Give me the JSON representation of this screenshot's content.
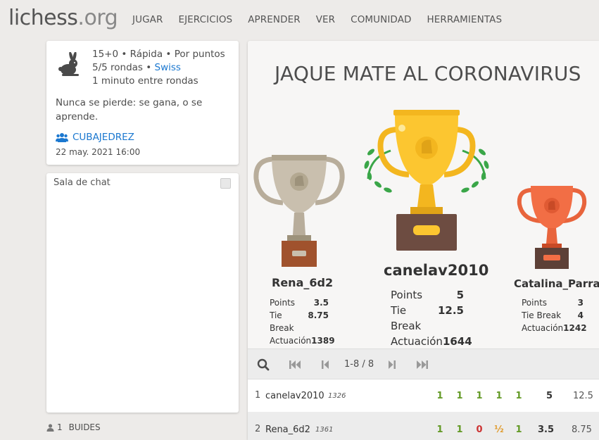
{
  "site": {
    "logo_main": "lichess",
    "logo_tld": ".org"
  },
  "nav": [
    "JUGAR",
    "EJERCICIOS",
    "APRENDER",
    "VER",
    "COMUNIDAD",
    "HERRAMIENTAS"
  ],
  "info": {
    "setup_line1": "15+0 • Rápida • Por puntos",
    "setup_line2_prefix": "5/5 rondas • ",
    "setup_line2_link": "Swiss",
    "setup_line3": "1 minuto entre rondas",
    "description": "Nunca se pierde: se gana, o se aprende.",
    "team": "CUBAJEDREZ",
    "date": "22 may. 2021 16:00"
  },
  "chat": {
    "title": "Sala de chat"
  },
  "spectators": {
    "count": "1",
    "label": "BUIDES"
  },
  "tournament": {
    "title": "JAQUE MATE AL CORONAVIRUS"
  },
  "podium": [
    {
      "place": 2,
      "name": "Rena_6d2",
      "points": "3.5",
      "tiebreak": "8.75",
      "performance": "1389"
    },
    {
      "place": 1,
      "name": "canelav2010",
      "points": "5",
      "tiebreak": "12.5",
      "performance": "1644"
    },
    {
      "place": 3,
      "name": "Catalina_Parra",
      "points": "3",
      "tiebreak": "4",
      "performance": "1242"
    }
  ],
  "stat_labels": {
    "points": "Points",
    "tiebreak": "Tie Break",
    "performance": "Actuación"
  },
  "pager": {
    "range": "1-8 / 8"
  },
  "standings": [
    {
      "rank": "1",
      "name": "canelav2010",
      "rating": "1326",
      "rounds": [
        "1",
        "1",
        "1",
        "1",
        "1"
      ],
      "total": "5",
      "tiebreak": "12.5"
    },
    {
      "rank": "2",
      "name": "Rena_6d2",
      "rating": "1361",
      "rounds": [
        "1",
        "1",
        "0",
        "½",
        "1"
      ],
      "total": "3.5",
      "tiebreak": "8.75"
    }
  ],
  "colors": {
    "link": "#1b78d0",
    "win": "#629924",
    "loss": "#cc3333",
    "draw": "#e09a2a"
  },
  "icons": [
    "rabbit-icon",
    "team-icon",
    "user-icon",
    "search-icon",
    "first-page-icon",
    "prev-page-icon",
    "next-page-icon",
    "last-page-icon"
  ]
}
